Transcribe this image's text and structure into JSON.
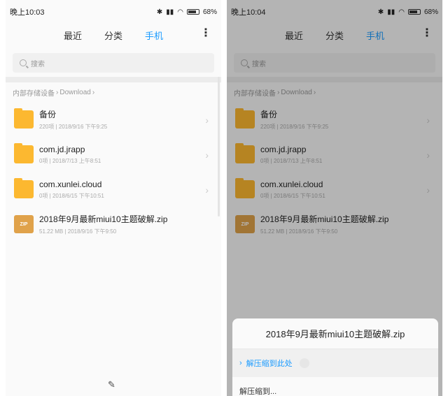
{
  "left": {
    "status": {
      "time": "晚上10:03",
      "battery": "68%"
    },
    "tabs": {
      "recent": "最近",
      "category": "分类",
      "phone": "手机"
    },
    "search": {
      "placeholder": "搜索"
    },
    "breadcrumb": {
      "root": "内部存储设备",
      "folder": "Download"
    },
    "items": [
      {
        "name": "备份",
        "meta": "220项 | 2018/9/16 下午9:25",
        "type": "folder"
      },
      {
        "name": "com.jd.jrapp",
        "meta": "0项 | 2018/7/13 上午8:51",
        "type": "folder"
      },
      {
        "name": "com.xunlei.cloud",
        "meta": "0项 | 2018/6/15 下午10:51",
        "type": "folder"
      },
      {
        "name": "2018年9月最新miui10主题破解.zip",
        "meta": "51.22 MB | 2018/9/16 下午9:50",
        "type": "zip",
        "badge": "ZIP"
      }
    ]
  },
  "right": {
    "status": {
      "time": "晚上10:04",
      "battery": "68%"
    },
    "tabs": {
      "recent": "最近",
      "category": "分类",
      "phone": "手机"
    },
    "search": {
      "placeholder": "搜索"
    },
    "breadcrumb": {
      "root": "内部存储设备",
      "folder": "Download"
    },
    "items": [
      {
        "name": "备份",
        "meta": "220项 | 2018/9/16 下午9:25",
        "type": "folder"
      },
      {
        "name": "com.jd.jrapp",
        "meta": "0项 | 2018/7/13 上午8:51",
        "type": "folder"
      },
      {
        "name": "com.xunlei.cloud",
        "meta": "0项 | 2018/6/15 下午10:51",
        "type": "folder"
      },
      {
        "name": "2018年9月最新miui10主题破解.zip",
        "meta": "51.22 MB | 2018/9/16 下午9:50",
        "type": "zip",
        "badge": "ZIP"
      }
    ],
    "sheet": {
      "title": "2018年9月最新miui10主题破解.zip",
      "option1": "解压缩到此处",
      "option2": "解压缩到..."
    }
  },
  "colors": {
    "accent": "#1a9bff",
    "folder": "#fcb830",
    "zip": "#e0a24a"
  },
  "icons": {
    "search": "search-icon",
    "more": "more-vertical-icon",
    "chevron": "chevron-right-icon",
    "clean": "broom-icon"
  }
}
